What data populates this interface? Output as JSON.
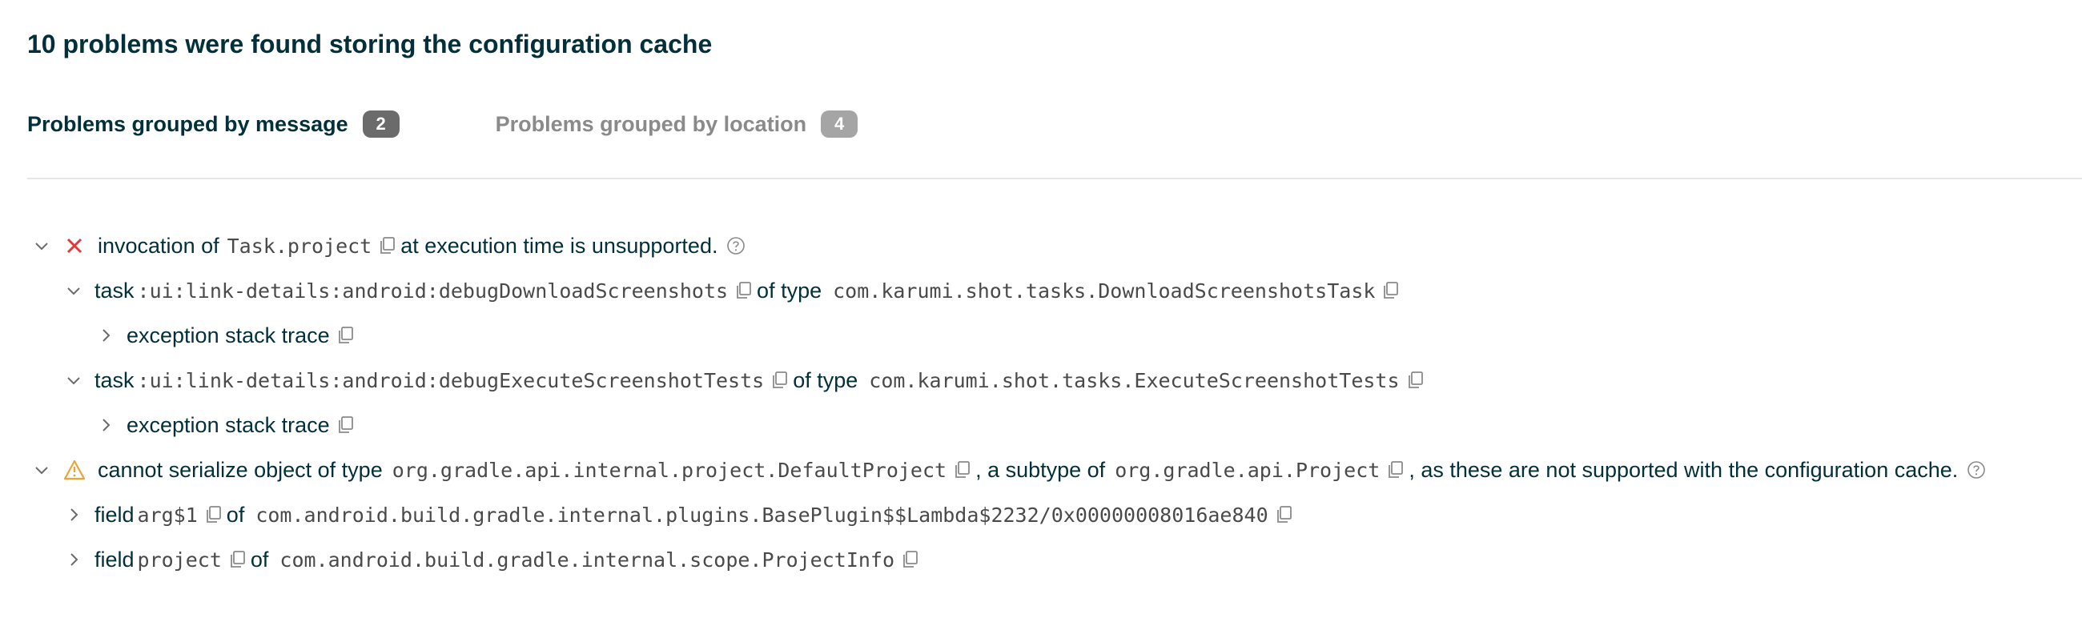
{
  "report": {
    "title": "10 problems were found storing the configuration cache"
  },
  "tabs": [
    {
      "label": "Problems grouped by message",
      "count": "2"
    },
    {
      "label": "Problems grouped by location",
      "count": "4"
    }
  ],
  "problems": [
    {
      "severity": "error",
      "pre": "invocation of ",
      "code": "Task.project",
      "post": "at execution time is unsupported.",
      "tasks": [
        {
          "kw": "task",
          "path": ":ui:link-details:android:debugDownloadScreenshots",
          "of": "of type",
          "type": "com.karumi.shot.tasks.DownloadScreenshotsTask",
          "child": "exception stack trace"
        },
        {
          "kw": "task",
          "path": ":ui:link-details:android:debugExecuteScreenshotTests",
          "of": "of type",
          "type": "com.karumi.shot.tasks.ExecuteScreenshotTests",
          "child": "exception stack trace"
        }
      ]
    },
    {
      "severity": "warning",
      "pre": "cannot serialize object of type",
      "code": "org.gradle.api.internal.project.DefaultProject",
      "mid": ", a subtype of",
      "code2": "org.gradle.api.Project",
      "post": ", as these are not supported with the configuration cache.",
      "fields": [
        {
          "kw": "field",
          "name": "arg$1",
          "of": "of",
          "type": "com.android.build.gradle.internal.plugins.BasePlugin$$Lambda$2232/0x00000008016ae840"
        },
        {
          "kw": "field",
          "name": "project",
          "of": "of",
          "type": "com.android.build.gradle.internal.scope.ProjectInfo"
        }
      ]
    }
  ],
  "colors": {
    "text": "#02303a",
    "error": "#e03a3a",
    "warning": "#e8a53a",
    "code": "#4a4a4a",
    "badge_active": "#6b6b6b",
    "badge_inactive": "#a5a5a5"
  },
  "icons": {
    "expanded": "chevron-down-icon",
    "collapsed": "chevron-right-icon",
    "error": "error-x-icon",
    "warning": "warning-triangle-icon",
    "copy": "copy-icon",
    "help": "help-circle-icon"
  }
}
